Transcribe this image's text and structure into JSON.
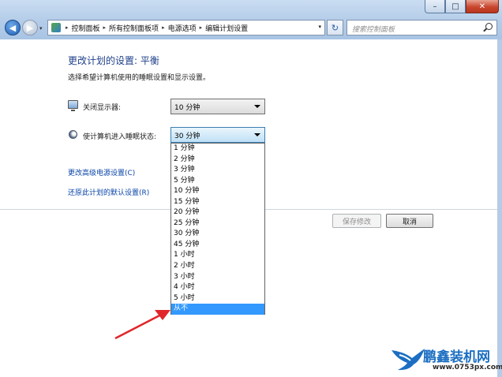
{
  "window": {
    "minimize_glyph": "–",
    "maximize_glyph": "□",
    "close_glyph": "✕"
  },
  "nav": {
    "back_glyph": "◀",
    "forward_glyph": "▶",
    "breadcrumbs": [
      "控制面板",
      "所有控制面板项",
      "电源选项",
      "编辑计划设置"
    ],
    "separator": "▸",
    "dropdown_glyph": "▾",
    "refresh_glyph": "↻",
    "search_placeholder": "搜索控制面板"
  },
  "page": {
    "title": "更改计划的设置: 平衡",
    "subtitle": "选择希望计算机使用的睡眠设置和显示设置。"
  },
  "settings": {
    "display_off_label": "关闭显示器:",
    "display_off_value": "10 分钟",
    "sleep_label": "使计算机进入睡眠状态:",
    "sleep_value": "30 分钟"
  },
  "sleep_options": [
    "1 分钟",
    "2 分钟",
    "3 分钟",
    "5 分钟",
    "10 分钟",
    "15 分钟",
    "20 分钟",
    "25 分钟",
    "30 分钟",
    "45 分钟",
    "1 小时",
    "2 小时",
    "3 小时",
    "4 小时",
    "5 小时",
    "从不"
  ],
  "selected_option_index": 15,
  "links": {
    "advanced": "更改高级电源设置(C)",
    "restore": "还原此计划的默认设置(R)"
  },
  "buttons": {
    "save": "保存修改",
    "cancel": "取消"
  },
  "watermark": {
    "title": "鹏鑫装机网",
    "url": "www.0753px.com"
  },
  "colors": {
    "link": "#0a45a8",
    "heading": "#1e3f8a",
    "selection": "#3399ff",
    "annotation_arrow": "#e0262a"
  }
}
